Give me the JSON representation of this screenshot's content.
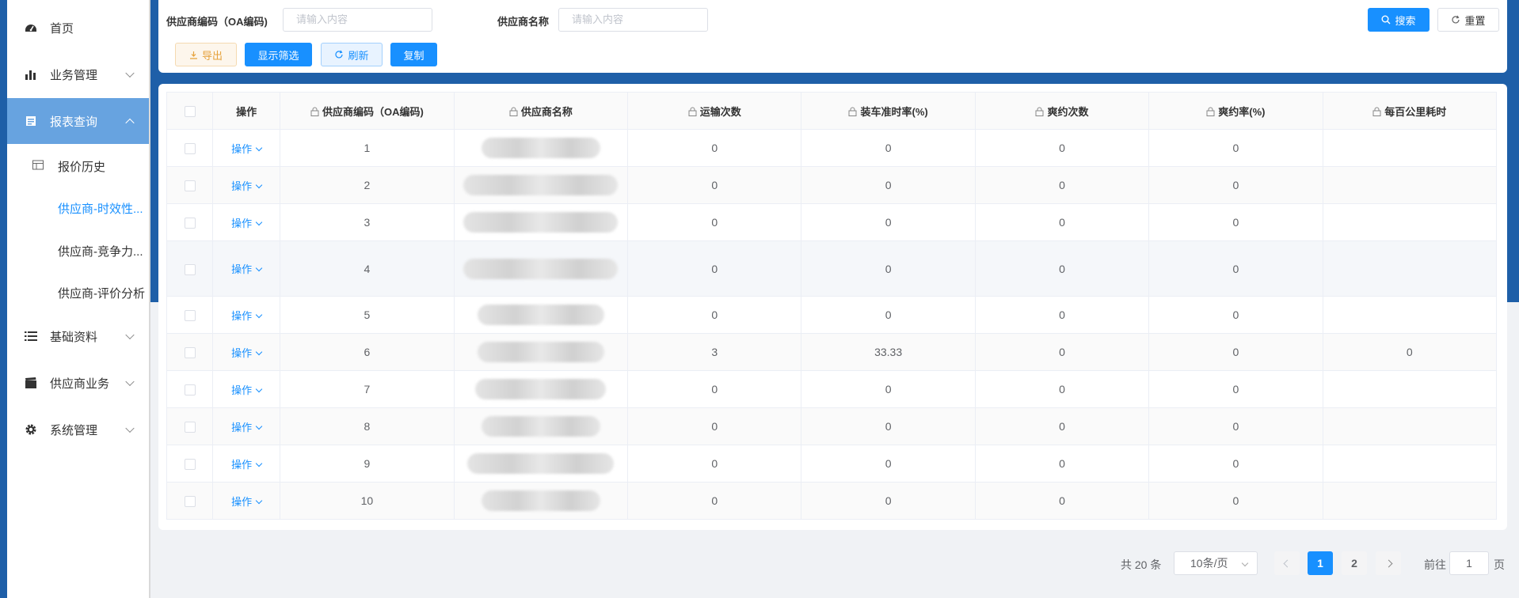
{
  "sidebar": {
    "items": [
      {
        "label": "首页",
        "icon": "dashboard-icon"
      },
      {
        "label": "业务管理",
        "icon": "bar-chart-icon"
      },
      {
        "label": "报表查询",
        "icon": "report-icon"
      },
      {
        "label": "基础资料",
        "icon": "list-icon"
      },
      {
        "label": "供应商业务",
        "icon": "clapper-icon"
      },
      {
        "label": "系统管理",
        "icon": "gear-icon"
      }
    ],
    "sub_items": [
      {
        "label": "报价历史",
        "icon": "table-icon"
      },
      {
        "label": "供应商-时效性..."
      },
      {
        "label": "供应商-竞争力..."
      },
      {
        "label": "供应商-评价分析"
      }
    ]
  },
  "search": {
    "code_label": "供应商编码（OA编码)",
    "code_placeholder": "请输入内容",
    "name_label": "供应商名称",
    "name_placeholder": "请输入内容",
    "search_label": "搜索",
    "reset_label": "重置"
  },
  "toolbar": {
    "export_label": "导出",
    "filter_label": "显示筛选",
    "refresh_label": "刷新",
    "copy_label": "复制"
  },
  "table": {
    "columns": [
      "操作",
      "供应商编码（OA编码)",
      "供应商名称",
      "运输次数",
      "装车准时率(%)",
      "爽约次数",
      "爽约率(%)",
      "每百公里耗时"
    ],
    "op_label": "操作",
    "rows": [
      {
        "code": "1",
        "trips": "0",
        "ontime": "0",
        "noshow": "0",
        "noshow_rate": "0",
        "time100": ""
      },
      {
        "code": "2",
        "trips": "0",
        "ontime": "0",
        "noshow": "0",
        "noshow_rate": "0",
        "time100": ""
      },
      {
        "code": "3",
        "trips": "0",
        "ontime": "0",
        "noshow": "0",
        "noshow_rate": "0",
        "time100": ""
      },
      {
        "code": "4",
        "trips": "0",
        "ontime": "0",
        "noshow": "0",
        "noshow_rate": "0",
        "time100": ""
      },
      {
        "code": "5",
        "trips": "0",
        "ontime": "0",
        "noshow": "0",
        "noshow_rate": "0",
        "time100": ""
      },
      {
        "code": "6",
        "trips": "3",
        "ontime": "33.33",
        "noshow": "0",
        "noshow_rate": "0",
        "time100": "0"
      },
      {
        "code": "7",
        "trips": "0",
        "ontime": "0",
        "noshow": "0",
        "noshow_rate": "0",
        "time100": ""
      },
      {
        "code": "8",
        "trips": "0",
        "ontime": "0",
        "noshow": "0",
        "noshow_rate": "0",
        "time100": ""
      },
      {
        "code": "9",
        "trips": "0",
        "ontime": "0",
        "noshow": "0",
        "noshow_rate": "0",
        "time100": ""
      },
      {
        "code": "10",
        "trips": "0",
        "ontime": "0",
        "noshow": "0",
        "noshow_rate": "0",
        "time100": ""
      }
    ]
  },
  "pagination": {
    "total_text": "共 20 条",
    "page_size": "10条/页",
    "pages": [
      "1",
      "2"
    ],
    "current_page": "1",
    "goto_prefix": "前往",
    "goto_value": "1",
    "goto_suffix": "页"
  },
  "colors": {
    "primary": "#1890ff",
    "header_bar": "#1e5fa8",
    "active_nav": "#67a3e0"
  }
}
